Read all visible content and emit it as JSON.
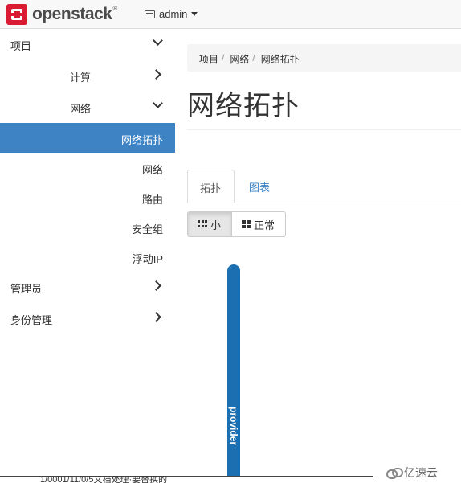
{
  "navbar": {
    "logo_text": "openstack",
    "logo_tm": "®",
    "project": "admin"
  },
  "sidebar": {
    "items": [
      {
        "label": "项目",
        "state": "expanded"
      },
      {
        "label": "计算",
        "state": "collapsed"
      },
      {
        "label": "网络",
        "state": "expanded"
      },
      {
        "label": "网络拓扑",
        "state": "active"
      },
      {
        "label": "网络"
      },
      {
        "label": "路由"
      },
      {
        "label": "安全组"
      },
      {
        "label": "浮动IP"
      },
      {
        "label": "管理员",
        "state": "collapsed"
      },
      {
        "label": "身份管理",
        "state": "collapsed"
      }
    ]
  },
  "breadcrumb": [
    "项目",
    "网络",
    "网络拓扑"
  ],
  "page_title": "网络拓扑",
  "tabs": [
    {
      "label": "拓扑",
      "active": true
    },
    {
      "label": "图表",
      "active": false
    }
  ],
  "view_toggle": {
    "small_label": "小",
    "normal_label": "正常",
    "selected": "小"
  },
  "topology": {
    "network_name": "provider",
    "network_color": "#1c6fb0"
  },
  "overlay_text": "1/0001/11/0/5文档处理·要替换的",
  "watermark": "亿速云",
  "colors": {
    "accent": "#3e84c5",
    "brand": "#da1a32"
  }
}
